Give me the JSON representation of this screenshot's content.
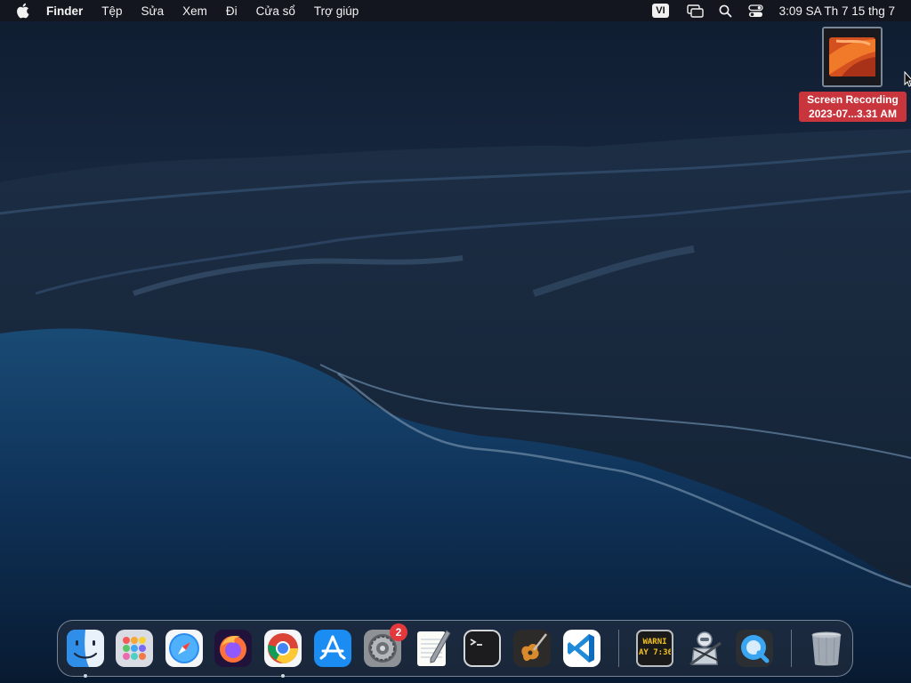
{
  "menubar": {
    "apple_icon": "apple-logo-icon",
    "items": [
      "Finder",
      "Tệp",
      "Sửa",
      "Xem",
      "Đi",
      "Cửa sổ",
      "Trợ giúp"
    ],
    "input_source": "VI",
    "tray_icons": [
      "screen-mirroring-icon",
      "spotlight-search-icon",
      "control-center-icon"
    ],
    "clock": "3:09 SA Th 7 15 thg 7"
  },
  "desktop": {
    "items": [
      {
        "label_line1": "Screen Recording",
        "label_line2": "2023-07...3.31 AM",
        "icon": "video-thumbnail-icon",
        "label_color": "#c9353d"
      }
    ]
  },
  "dock": {
    "apps": [
      {
        "name": "Finder",
        "icon": "finder-icon",
        "running": true
      },
      {
        "name": "Launchpad",
        "icon": "launchpad-icon",
        "running": false
      },
      {
        "name": "Safari",
        "icon": "safari-icon",
        "running": false
      },
      {
        "name": "Firefox",
        "icon": "firefox-icon",
        "running": false
      },
      {
        "name": "Google Chrome",
        "icon": "chrome-icon",
        "running": true
      },
      {
        "name": "App Store",
        "icon": "app-store-icon",
        "running": false
      },
      {
        "name": "System Settings",
        "icon": "system-settings-icon",
        "running": false,
        "badge": "2"
      },
      {
        "name": "TextEdit",
        "icon": "textedit-icon",
        "running": false
      },
      {
        "name": "Terminal",
        "icon": "terminal-icon",
        "running": false
      },
      {
        "name": "GarageBand",
        "icon": "garageband-icon",
        "running": false
      },
      {
        "name": "Visual Studio Code",
        "icon": "vscode-icon",
        "running": false
      },
      {
        "name": "Console",
        "icon": "console-icon",
        "running": false,
        "icon_text_line1": "WARNI",
        "icon_text_line2": "AY 7:36"
      },
      {
        "name": "Automator",
        "icon": "automator-icon",
        "running": false
      },
      {
        "name": "QuickTime Player",
        "icon": "quicktime-icon",
        "running": false
      },
      {
        "name": "Trash",
        "icon": "trash-icon",
        "running": false
      }
    ]
  },
  "colors": {
    "menubar_bg": "#14161c",
    "badge_red": "#e3393c",
    "label_red": "#c9353d",
    "ocean": "#0e2a48"
  }
}
